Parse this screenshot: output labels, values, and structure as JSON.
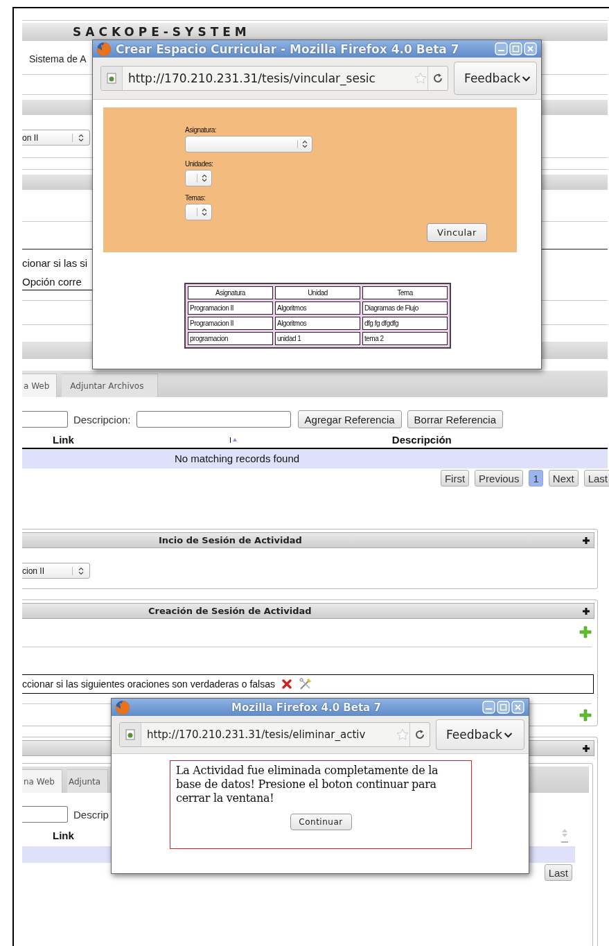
{
  "background_page": {
    "header_title": "SACKOPE-SYSTEM",
    "subtitle": "Sistema de A",
    "subject_select": {
      "value": "on II"
    },
    "question_text": "cionar si las si",
    "option_link": "Opción corre",
    "reference_tabs": [
      {
        "label": "a Web",
        "selected": true
      },
      {
        "label": "Adjuntar Archivos",
        "selected": false
      }
    ],
    "reference_form": {
      "description_label": "Descripcion:",
      "buttons": [
        "Agregar Referencia",
        "Borrar Referencia"
      ]
    },
    "reference_table": {
      "columns": [
        "Link",
        "Descripción"
      ],
      "empty_message": "No matching records found"
    },
    "pagination": [
      {
        "label": "First",
        "selected": false
      },
      {
        "label": "Previous",
        "selected": false
      },
      {
        "label": "1",
        "selected": true
      },
      {
        "label": "Next",
        "selected": false
      },
      {
        "label": "Last",
        "selected": false
      }
    ],
    "session_start_panel": {
      "title": "Incio de Sesión de Actividad",
      "select_value": "cion II"
    },
    "session_create_panel": {
      "title": "Creación de Sesión de Actividad",
      "question": "ccionar si las siguientes oraciones son verdaderas o falsas"
    },
    "activity_panel": {
      "tabs": [
        {
          "label": "na Web",
          "selected": true
        },
        {
          "label": "Adjunta",
          "selected": false
        }
      ],
      "description_label": "Descrip",
      "columns": [
        "Link"
      ],
      "pagination": [
        "Last"
      ]
    }
  },
  "link_window": {
    "title": "Crear Espacio Curricular - Mozilla Firefox 4.0 Beta 7",
    "url": "http://170.210.231.31/tesis/vincular_sesic",
    "feedback": "Feedback",
    "fields": [
      {
        "label": "Asignatura:",
        "kind": "wide"
      },
      {
        "label": "Unidades:",
        "kind": "narrow"
      },
      {
        "label": "Temas:",
        "kind": "narrow"
      }
    ],
    "button": "Vincular",
    "table": {
      "columns": [
        "Asignatura",
        "Unidad",
        "Tema"
      ],
      "rows": [
        [
          "Programacion II",
          "Algoritmos",
          "Diagramas de Flujo"
        ],
        [
          "Programacion II",
          "Algoritmos",
          "dfg fg dfgdfg"
        ],
        [
          "programacion",
          "unidad 1",
          "tema 2"
        ]
      ]
    }
  },
  "message_window": {
    "title": "Mozilla Firefox 4.0 Beta 7",
    "url": "http://170.210.231.31/tesis/eliminar_activ",
    "feedback": "Feedback",
    "message": "La Actividad fue eliminada completamente de la base de datos! Presione el boton continuar para cerrar la ventana!",
    "button": "Continuar"
  }
}
